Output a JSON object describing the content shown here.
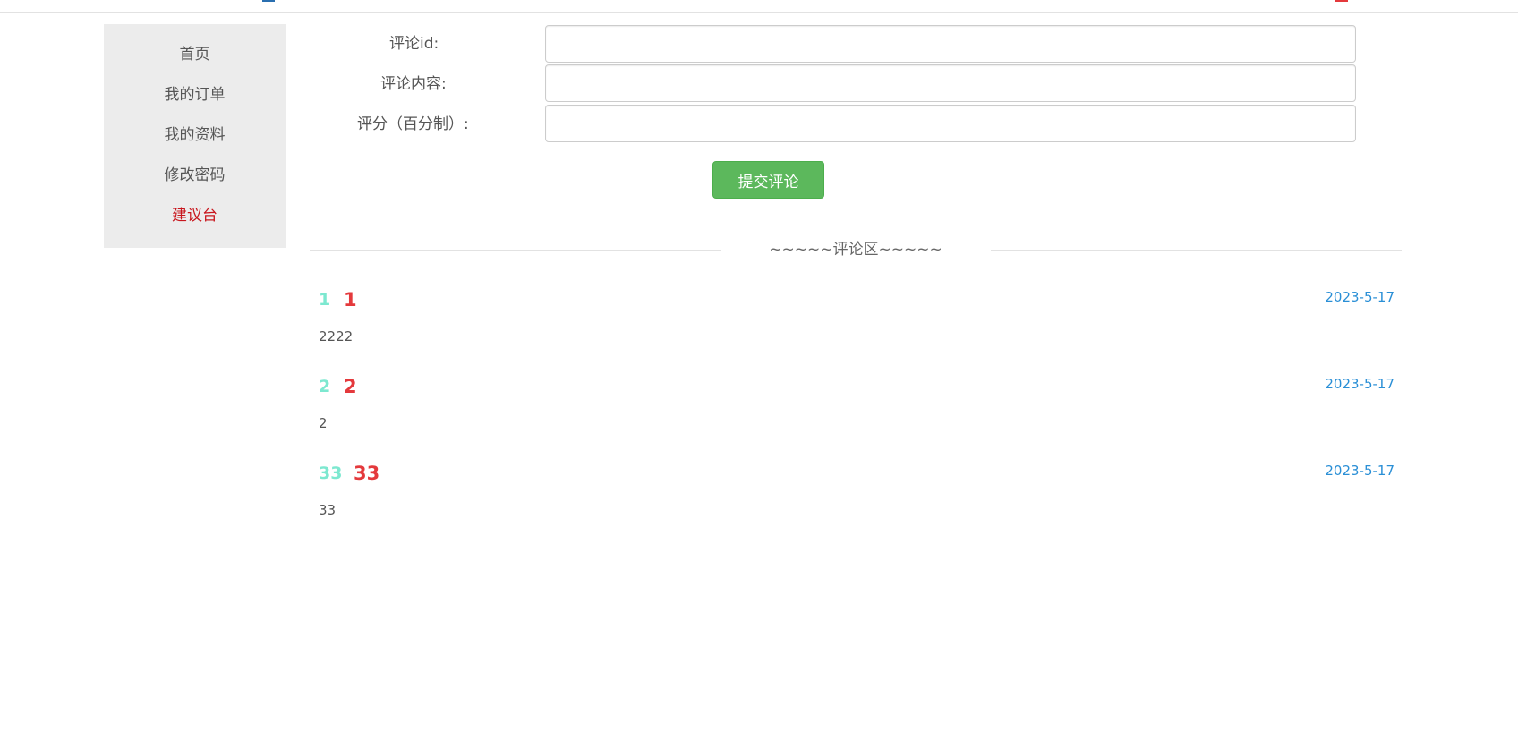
{
  "sidebar": {
    "items": [
      {
        "label": "首页"
      },
      {
        "label": "我的订单"
      },
      {
        "label": "我的资料"
      },
      {
        "label": "修改密码"
      },
      {
        "label": "建议台"
      }
    ],
    "active_index": 4
  },
  "form": {
    "comment_id_label": "评论id:",
    "comment_id_value": "",
    "content_label": "评论内容:",
    "content_value": "",
    "score_label": "评分（百分制）:",
    "score_value": "",
    "submit_label": "提交评论"
  },
  "comment_section": {
    "title": "~~~~~评论区~~~~~",
    "comments": [
      {
        "id": "1",
        "score": "1",
        "date": "2023-5-17",
        "content": "2222"
      },
      {
        "id": "2",
        "score": "2",
        "date": "2023-5-17",
        "content": "2"
      },
      {
        "id": "33",
        "score": "33",
        "date": "2023-5-17",
        "content": "33"
      }
    ]
  },
  "colors": {
    "sidebar_bg": "#ececec",
    "active": "#c8161d",
    "submit": "#5cb85c",
    "comment_id": "#7de8d0",
    "comment_score": "#e4393c",
    "date": "#2a8fd6"
  }
}
